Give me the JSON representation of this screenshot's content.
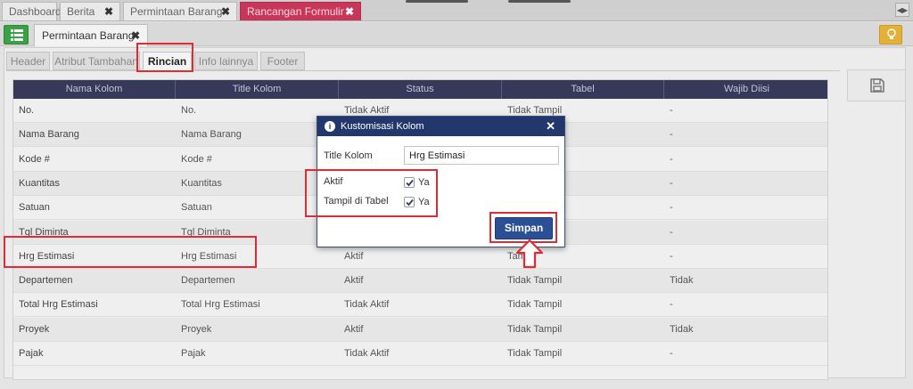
{
  "top_tabs": [
    {
      "label": "Dashboard",
      "closable": false
    },
    {
      "label": "Berita",
      "closable": true
    },
    {
      "label": "Permintaan Barang",
      "closable": true
    },
    {
      "label": "Rancangan Formulir",
      "closable": true,
      "active": true
    }
  ],
  "document_tab": {
    "label": "Permintaan Barang"
  },
  "section_tabs": [
    {
      "label": "Header"
    },
    {
      "label": "Atribut Tambahan"
    },
    {
      "label": "Rincian",
      "active": true
    },
    {
      "label": "Info lainnya"
    },
    {
      "label": "Footer"
    }
  ],
  "grid": {
    "columns": [
      "Nama Kolom",
      "Title Kolom",
      "Status",
      "Tabel",
      "Wajib Diisi"
    ],
    "rows": [
      {
        "nama": "No.",
        "title": "No.",
        "status": "Tidak Aktif",
        "tabel": "Tidak Tampil",
        "wajib": "-"
      },
      {
        "nama": "Nama Barang",
        "title": "Nama Barang",
        "status": "",
        "tabel": "",
        "wajib": "-"
      },
      {
        "nama": "Kode #",
        "title": "Kode #",
        "status": "",
        "tabel": "",
        "wajib": "-"
      },
      {
        "nama": "Kuantitas",
        "title": "Kuantitas",
        "status": "",
        "tabel": "",
        "wajib": "-"
      },
      {
        "nama": "Satuan",
        "title": "Satuan",
        "status": "",
        "tabel": "",
        "wajib": "-"
      },
      {
        "nama": "Tgl Diminta",
        "title": "Tgl Diminta",
        "status": "",
        "tabel": "",
        "wajib": "-"
      },
      {
        "nama": "Hrg Estimasi",
        "title": "Hrg Estimasi",
        "status": "Aktif",
        "tabel": "Tampil",
        "wajib": "-"
      },
      {
        "nama": "Departemen",
        "title": "Departemen",
        "status": "Aktif",
        "tabel": "Tidak Tampil",
        "wajib": "Tidak"
      },
      {
        "nama": "Total Hrg Estimasi",
        "title": "Total Hrg Estimasi",
        "status": "Tidak Aktif",
        "tabel": "Tidak Tampil",
        "wajib": "-"
      },
      {
        "nama": "Proyek",
        "title": "Proyek",
        "status": "Aktif",
        "tabel": "Tidak Tampil",
        "wajib": "Tidak"
      },
      {
        "nama": "Pajak",
        "title": "Pajak",
        "status": "Tidak Aktif",
        "tabel": "Tidak Tampil",
        "wajib": "-"
      }
    ]
  },
  "modal": {
    "title": "Kustomisasi Kolom",
    "title_kolom_label": "Title Kolom",
    "title_kolom_value": "Hrg Estimasi",
    "aktif_label": "Aktif",
    "aktif_checked": true,
    "aktif_option": "Ya",
    "tampil_label": "Tampil di Tabel",
    "tampil_checked": true,
    "tampil_option": "Ya",
    "save_label": "Simpan"
  },
  "icons": [
    "menu-list-icon",
    "lightbulb-icon",
    "floppy-disk-icon",
    "info-icon",
    "close-icon",
    "checkmark-icon",
    "arrow-up-icon",
    "scroll-arrow-icon"
  ],
  "colors": {
    "active_tab": "#c8365a",
    "grid_header": "#35395a",
    "modal_header": "#22376b",
    "primary_button": "#2a4f94",
    "menu_button": "#39a244",
    "bulb_button": "#e3b13a",
    "highlight": "#e02b35"
  }
}
